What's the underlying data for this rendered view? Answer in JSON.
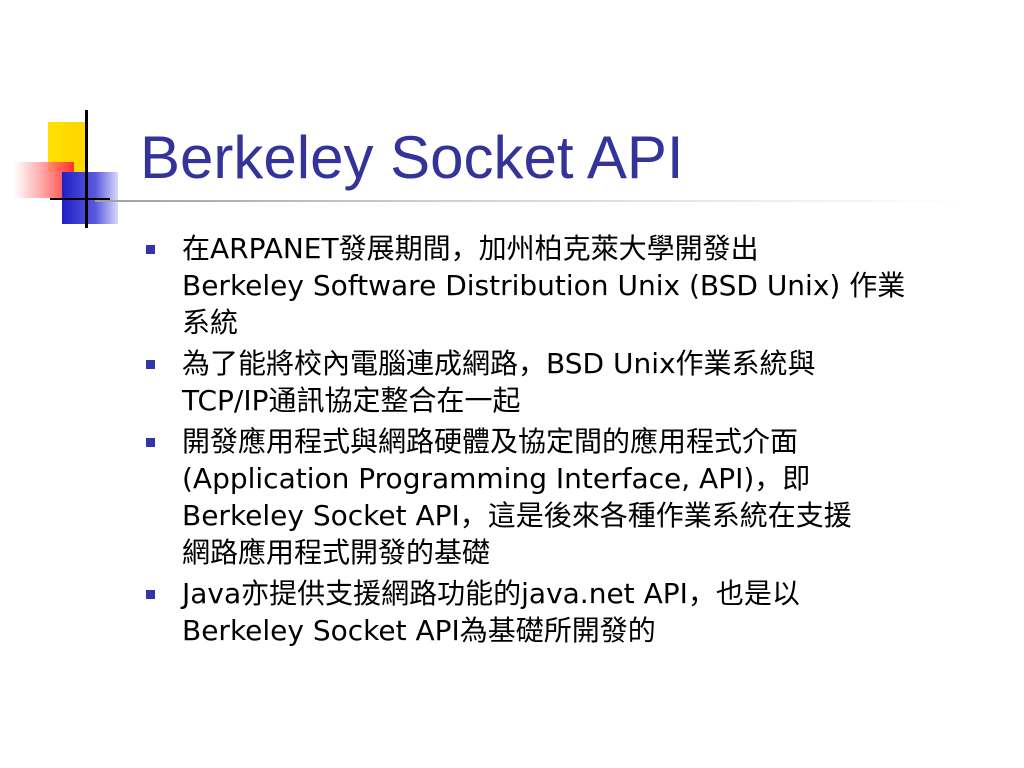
{
  "slide": {
    "title": "Berkeley Socket API",
    "accent_color": "#333399",
    "bullet_color": "#3333aa",
    "bullets": [
      {
        "lines": [
          "在ARPANET發展期間，加州柏克萊大學開發出",
          "Berkeley Software Distribution Unix (BSD Unix) 作業",
          "系統"
        ]
      },
      {
        "lines": [
          "為了能將校內電腦連成網路，BSD Unix作業系統與",
          "TCP/IP通訊協定整合在一起"
        ]
      },
      {
        "lines": [
          "開發應用程式與網路硬體及協定間的應用程式介面",
          "(Application Programming Interface, API)，即",
          "Berkeley Socket API，這是後來各種作業系統在支援",
          "網路應用程式開發的基礎"
        ]
      },
      {
        "lines": [
          "Java亦提供支援網路功能的java.net API，也是以",
          "Berkeley Socket API為基礎所開發的"
        ]
      }
    ]
  }
}
